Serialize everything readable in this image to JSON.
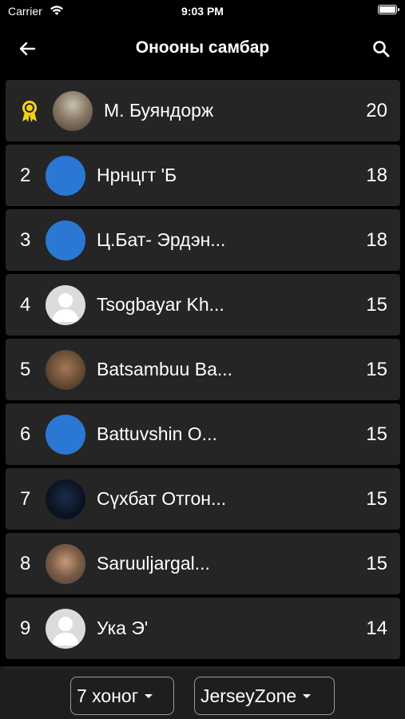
{
  "status_bar": {
    "carrier": "Carrier",
    "time": "9:03 PM"
  },
  "nav": {
    "title": "Онооны самбар",
    "back_icon": "arrow-left-icon",
    "search_icon": "search-icon"
  },
  "leaderboard": [
    {
      "rank": "1",
      "name": "М. Буяндорж",
      "score": "20",
      "avatar": "photo"
    },
    {
      "rank": "2",
      "name": "Нрнцгт 'Б",
      "score": "18",
      "avatar": "blue"
    },
    {
      "rank": "3",
      "name": "Ц.Бат- Эрдэн...",
      "score": "18",
      "avatar": "blue"
    },
    {
      "rank": "4",
      "name": "Tsogbayar Kh...",
      "score": "15",
      "avatar": "default"
    },
    {
      "rank": "5",
      "name": "Batsambuu Ba...",
      "score": "15",
      "avatar": "photo"
    },
    {
      "rank": "6",
      "name": "Battuvshin O...",
      "score": "15",
      "avatar": "blue"
    },
    {
      "rank": "7",
      "name": "Сүхбат Отгон...",
      "score": "15",
      "avatar": "photo"
    },
    {
      "rank": "8",
      "name": "Saruuljargal...",
      "score": "15",
      "avatar": "photo"
    },
    {
      "rank": "9",
      "name": "Ука Э'",
      "score": "14",
      "avatar": "default"
    }
  ],
  "filters": {
    "period": "7 хоног",
    "club": "JerseyZone"
  },
  "colors": {
    "background": "#000000",
    "row": "#252525",
    "avatar_blue": "#2a78d4",
    "medal": "#f2d21b"
  }
}
